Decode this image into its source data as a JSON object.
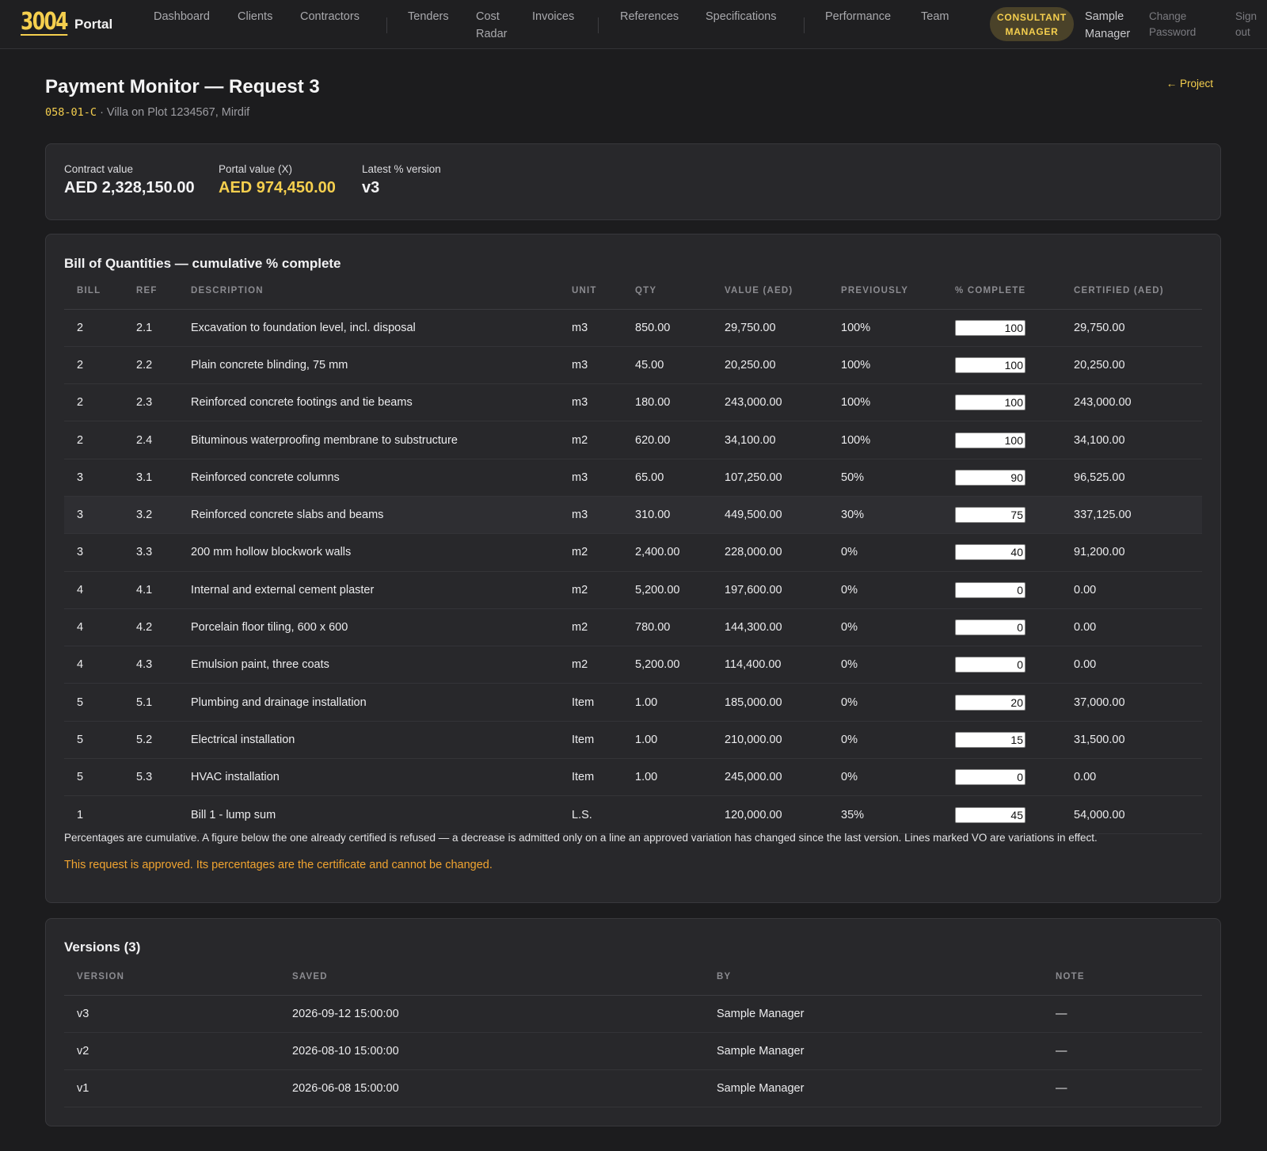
{
  "nav": {
    "brand_number": "3004",
    "brand_name": "Portal",
    "links": [
      "Dashboard",
      "Clients",
      "Contractors",
      "Tenders",
      "Cost Radar",
      "Invoices",
      "References",
      "Specifications",
      "Performance",
      "Team"
    ],
    "role_badge": "CONSULTANT MANAGER",
    "user": "Sample Manager",
    "change_password": "Change Password",
    "sign_out": "Sign out"
  },
  "header": {
    "title": "Payment Monitor — Request 3",
    "project_code": "058-01-C",
    "project_name": "· Villa on Plot 1234567, Mirdif",
    "back_link": "← Project"
  },
  "summary": {
    "contract_label": "Contract value",
    "contract_value": "AED 2,328,150.00",
    "portal_label": "Portal value (X)",
    "portal_value": "AED 974,450.00",
    "version_label": "Latest % version",
    "version_value": "v3"
  },
  "boq": {
    "title": "Bill of Quantities — cumulative % complete",
    "columns": [
      "BILL",
      "REF",
      "DESCRIPTION",
      "UNIT",
      "QTY",
      "VALUE (AED)",
      "PREVIOUSLY",
      "% COMPLETE",
      "CERTIFIED (AED)"
    ],
    "rows": [
      {
        "bill": "2",
        "ref": "2.1",
        "desc": "Excavation to foundation level, incl. disposal",
        "unit": "m3",
        "qty": "850.00",
        "value": "29,750.00",
        "prev": "100%",
        "pct": "100",
        "cert": "29,750.00"
      },
      {
        "bill": "2",
        "ref": "2.2",
        "desc": "Plain concrete blinding, 75 mm",
        "unit": "m3",
        "qty": "45.00",
        "value": "20,250.00",
        "prev": "100%",
        "pct": "100",
        "cert": "20,250.00"
      },
      {
        "bill": "2",
        "ref": "2.3",
        "desc": "Reinforced concrete footings and tie beams",
        "unit": "m3",
        "qty": "180.00",
        "value": "243,000.00",
        "prev": "100%",
        "pct": "100",
        "cert": "243,000.00"
      },
      {
        "bill": "2",
        "ref": "2.4",
        "desc": "Bituminous waterproofing membrane to substructure",
        "unit": "m2",
        "qty": "620.00",
        "value": "34,100.00",
        "prev": "100%",
        "pct": "100",
        "cert": "34,100.00"
      },
      {
        "bill": "3",
        "ref": "3.1",
        "desc": "Reinforced concrete columns",
        "unit": "m3",
        "qty": "65.00",
        "value": "107,250.00",
        "prev": "50%",
        "pct": "90",
        "cert": "96,525.00"
      },
      {
        "bill": "3",
        "ref": "3.2",
        "desc": "Reinforced concrete slabs and beams",
        "unit": "m3",
        "qty": "310.00",
        "value": "449,500.00",
        "prev": "30%",
        "pct": "75",
        "cert": "337,125.00"
      },
      {
        "bill": "3",
        "ref": "3.3",
        "desc": "200 mm hollow blockwork walls",
        "unit": "m2",
        "qty": "2,400.00",
        "value": "228,000.00",
        "prev": "0%",
        "pct": "40",
        "cert": "91,200.00"
      },
      {
        "bill": "4",
        "ref": "4.1",
        "desc": "Internal and external cement plaster",
        "unit": "m2",
        "qty": "5,200.00",
        "value": "197,600.00",
        "prev": "0%",
        "pct": "0",
        "cert": "0.00"
      },
      {
        "bill": "4",
        "ref": "4.2",
        "desc": "Porcelain floor tiling, 600 x 600",
        "unit": "m2",
        "qty": "780.00",
        "value": "144,300.00",
        "prev": "0%",
        "pct": "0",
        "cert": "0.00"
      },
      {
        "bill": "4",
        "ref": "4.3",
        "desc": "Emulsion paint, three coats",
        "unit": "m2",
        "qty": "5,200.00",
        "value": "114,400.00",
        "prev": "0%",
        "pct": "0",
        "cert": "0.00"
      },
      {
        "bill": "5",
        "ref": "5.1",
        "desc": "Plumbing and drainage installation",
        "unit": "Item",
        "qty": "1.00",
        "value": "185,000.00",
        "prev": "0%",
        "pct": "20",
        "cert": "37,000.00"
      },
      {
        "bill": "5",
        "ref": "5.2",
        "desc": "Electrical installation",
        "unit": "Item",
        "qty": "1.00",
        "value": "210,000.00",
        "prev": "0%",
        "pct": "15",
        "cert": "31,500.00"
      },
      {
        "bill": "5",
        "ref": "5.3",
        "desc": "HVAC installation",
        "unit": "Item",
        "qty": "1.00",
        "value": "245,000.00",
        "prev": "0%",
        "pct": "0",
        "cert": "0.00"
      },
      {
        "bill": "1",
        "ref": "",
        "desc": "Bill 1 - lump sum",
        "unit": "L.S.",
        "qty": "",
        "value": "120,000.00",
        "prev": "35%",
        "pct": "45",
        "cert": "54,000.00"
      }
    ],
    "note": "Percentages are cumulative. A figure below the one already certified is refused — a decrease is admitted only on a line an approved variation has changed since the last version. Lines marked VO are variations in effect.",
    "approved_msg": "This request is approved. Its percentages are the certificate and cannot be changed."
  },
  "versions": {
    "title": "Versions (3)",
    "columns": [
      "VERSION",
      "SAVED",
      "BY",
      "NOTE"
    ],
    "rows": [
      {
        "version": "v3",
        "saved": "2026-09-12 15:00:00",
        "by": "Sample Manager",
        "note": "—"
      },
      {
        "version": "v2",
        "saved": "2026-08-10 15:00:00",
        "by": "Sample Manager",
        "note": "—"
      },
      {
        "version": "v1",
        "saved": "2026-06-08 15:00:00",
        "by": "Sample Manager",
        "note": "—"
      }
    ]
  },
  "colors": {
    "accent": "#f5cf4e",
    "background": "#1c1c1e",
    "card": "#28282b",
    "approved": "#f1a430"
  }
}
